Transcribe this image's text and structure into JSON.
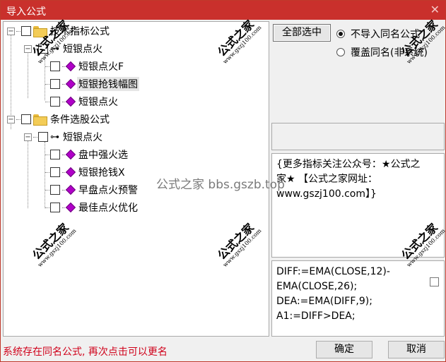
{
  "window": {
    "title": "导入公式",
    "close_glyph": "✕"
  },
  "tree": {
    "nodes": [
      {
        "label": "技术指标公式"
      },
      {
        "label": "短银点火"
      },
      {
        "label": "短银点火F"
      },
      {
        "label": "短银抢钱幅图"
      },
      {
        "label": "短银点火"
      },
      {
        "label": "条件选股公式"
      },
      {
        "label": "短银点火"
      },
      {
        "label": "盘中强火选"
      },
      {
        "label": "短银抢钱X"
      },
      {
        "label": "早盘点火预警"
      },
      {
        "label": "最佳点火优化"
      }
    ],
    "expander_glyph": "−",
    "key_glyph": "⊶"
  },
  "right": {
    "select_all_label": "全部选中",
    "radio_options": [
      {
        "label": "不导入同名公式",
        "checked": true
      },
      {
        "label": "覆盖同名(非系统)",
        "checked": false
      }
    ],
    "description": "{更多指标关注公众号：★公式之家★ 【公式之家网址：www.gszj100.com】}",
    "code": "DIFF:=EMA(CLOSE,12)-EMA(CLOSE,26);\nDEA:=EMA(DIFF,9);\nA1:=DIFF>DEA;"
  },
  "footer": {
    "status": "系统存在同名公式, 再次点击可以更名",
    "ok_label": "确定",
    "cancel_label": "取消"
  },
  "watermarks": {
    "stamp_title": "公式之家",
    "stamp_url": "www.gszj100.com",
    "center_text": "公式之家 bbs.gszb.top"
  },
  "colors": {
    "title_bar": "#c9302c",
    "status_text": "#d0021b",
    "diamond": "#b000c8",
    "folder": "#f3cc57"
  }
}
